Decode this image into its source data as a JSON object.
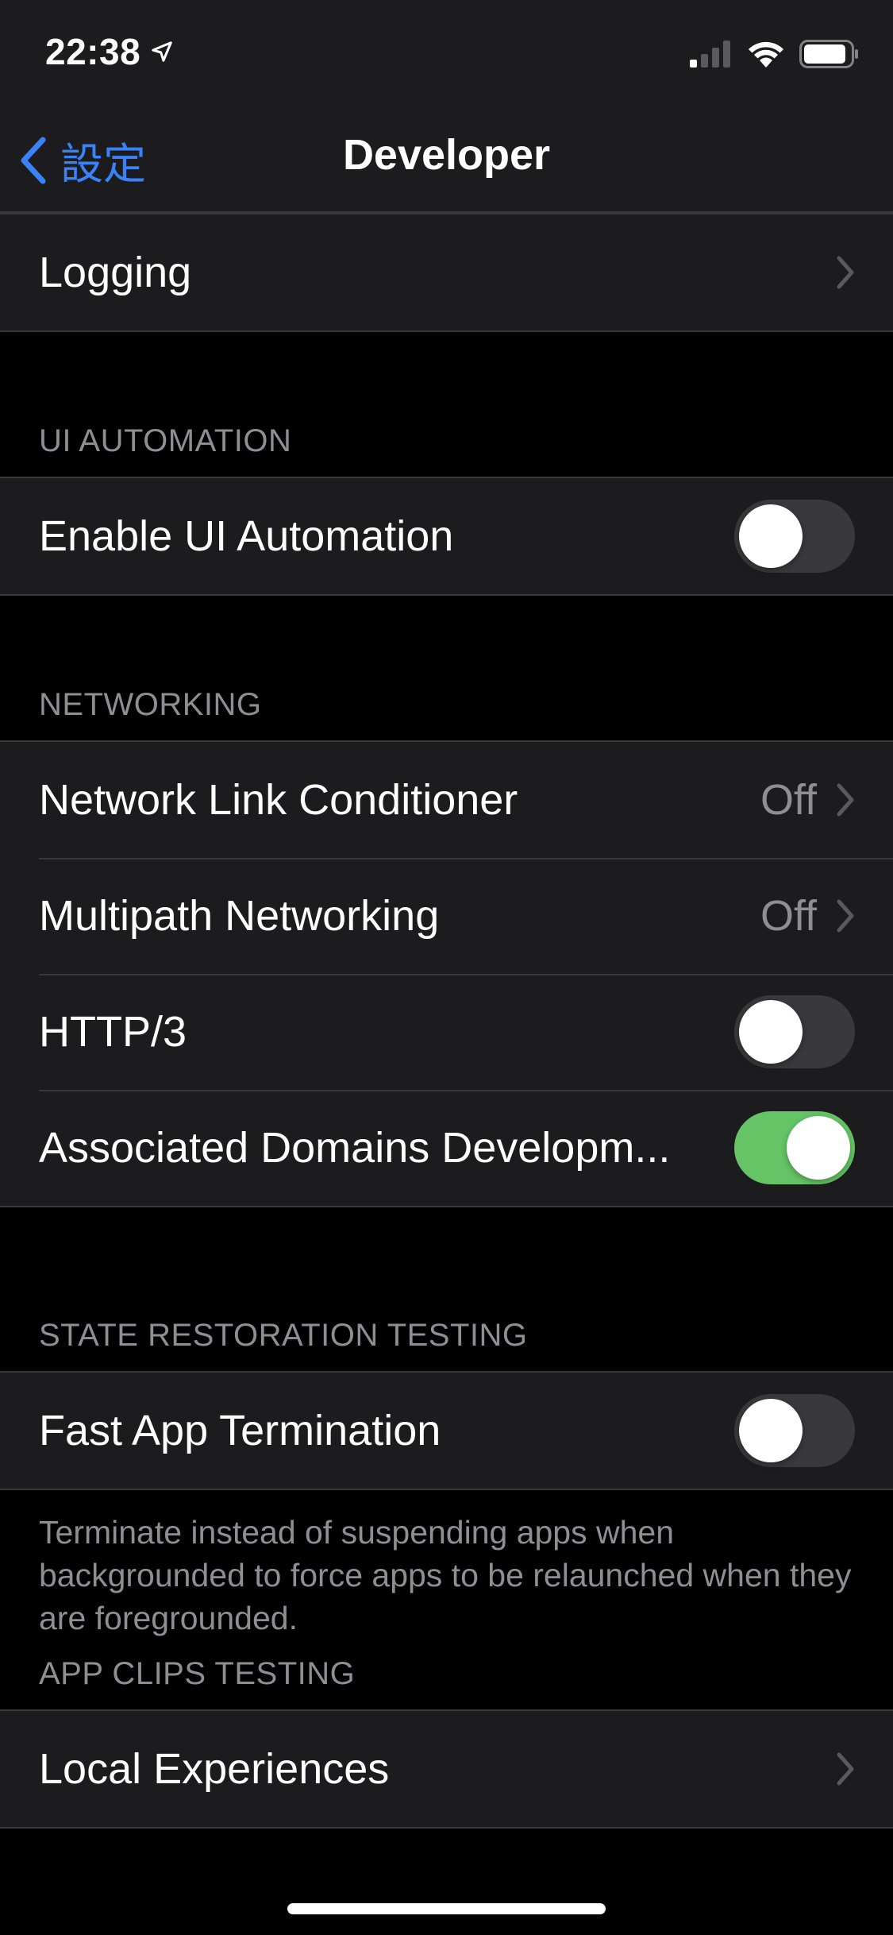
{
  "status_bar": {
    "time": "22:38",
    "icons": [
      "location-arrow-icon",
      "cellular-signal-icon",
      "wifi-icon",
      "battery-icon"
    ]
  },
  "nav": {
    "back_label": "設定",
    "title": "Developer",
    "accent_color": "#3a82f7"
  },
  "rows": {
    "logging": "Logging"
  },
  "sections": {
    "ui_automation": {
      "header": "UI AUTOMATION",
      "enable_ui_automation": {
        "label": "Enable UI Automation",
        "on": false
      }
    },
    "networking": {
      "header": "NETWORKING",
      "network_link_conditioner": {
        "label": "Network Link Conditioner",
        "value": "Off"
      },
      "multipath_networking": {
        "label": "Multipath Networking",
        "value": "Off"
      },
      "http3": {
        "label": "HTTP/3",
        "on": false
      },
      "associated_domains": {
        "label": "Associated Domains Developm...",
        "on": true
      }
    },
    "state_restoration": {
      "header": "STATE RESTORATION TESTING",
      "fast_app_termination": {
        "label": "Fast App Termination",
        "on": false
      },
      "footer": "Terminate instead of suspending apps when backgrounded to force apps to be relaunched when they are foregrounded."
    },
    "app_clips": {
      "header": "APP CLIPS TESTING",
      "local_experiences": {
        "label": "Local Experiences"
      }
    }
  },
  "colors": {
    "toggle_on": "#65c466",
    "toggle_off": "#39393d",
    "cell_background": "#1c1c1e",
    "secondary_text": "#8e8e93"
  }
}
